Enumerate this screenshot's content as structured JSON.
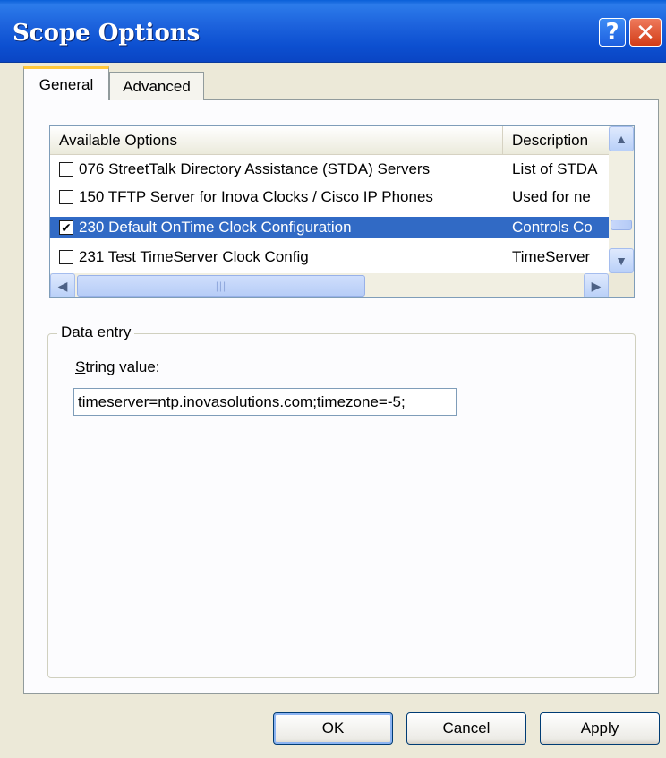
{
  "window": {
    "title": "Scope Options",
    "help_glyph": "?",
    "close_glyph": "✕"
  },
  "tabs": [
    {
      "label": "General",
      "active": true
    },
    {
      "label": "Advanced",
      "active": false
    }
  ],
  "options_list": {
    "columns": [
      "Available Options",
      "Description"
    ],
    "rows": [
      {
        "checked": false,
        "name": "076 StreetTalk Directory Assistance (STDA) Servers",
        "description": "List of STDA"
      },
      {
        "checked": false,
        "name": "150 TFTP Server for Inova Clocks / Cisco IP Phones",
        "description": "Used for ne"
      },
      {
        "checked": true,
        "name": "230 Default OnTime Clock Configuration",
        "description": "Controls Co",
        "selected": true
      },
      {
        "checked": false,
        "name": "231 Test TimeServer Clock Config",
        "description": "TimeServer"
      }
    ],
    "check_glyph": "✔",
    "scroll_up_glyph": "▲",
    "scroll_down_glyph": "▼",
    "scroll_left_glyph": "◀",
    "scroll_right_glyph": "▶",
    "grip_glyph": "|||"
  },
  "data_entry": {
    "legend": "Data entry",
    "label_accel": "S",
    "label_rest": "tring value:",
    "value": "timeserver=ntp.inovasolutions.com;timezone=-5;"
  },
  "buttons": {
    "ok": "OK",
    "cancel": "Cancel",
    "apply": "Apply"
  },
  "colors": {
    "title_bar": "#1d63dd",
    "selection": "#316ac5",
    "dialog_bg": "#ece9d8"
  }
}
